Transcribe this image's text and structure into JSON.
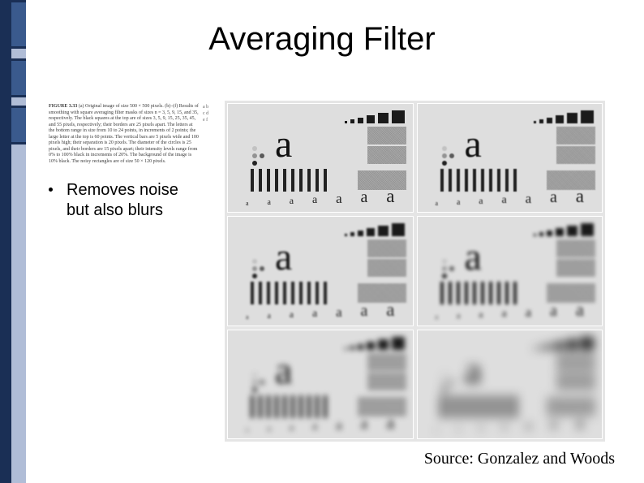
{
  "title": "Averaging Filter",
  "caption": {
    "fignum": "FIGURE 3.33",
    "text": "(a) Original image of size 500 × 500 pixels. (b)–(f) Results of smoothing with square averaging filter masks of sizes n = 3, 5, 9, 15, and 35, respectively. The black squares at the top are of sizes 3, 5, 9, 15, 25, 35, 45, and 55 pixels, respectively; their borders are 25 pixels apart. The letters at the bottom range in size from 10 to 24 points, in increments of 2 points; the large letter at the top is 60 points. The vertical bars are 5 pixels wide and 100 pixels high; their separation is 20 pixels. The diameter of the circles is 25 pixels, and their borders are 15 pixels apart; their intensity levels range from 0% to 100% black in increments of 20%. The background of the image is 10% black. The noisy rectangles are of size 50 × 120 pixels."
  },
  "cside": [
    "a b",
    "c d",
    "e f"
  ],
  "bullet": "Removes noise but also blurs",
  "source": "Source: Gonzalez and Woods",
  "panel": {
    "tiny_a": [
      "a",
      "a",
      "a",
      "a",
      "a",
      "a",
      "a"
    ],
    "big_a": "a"
  }
}
